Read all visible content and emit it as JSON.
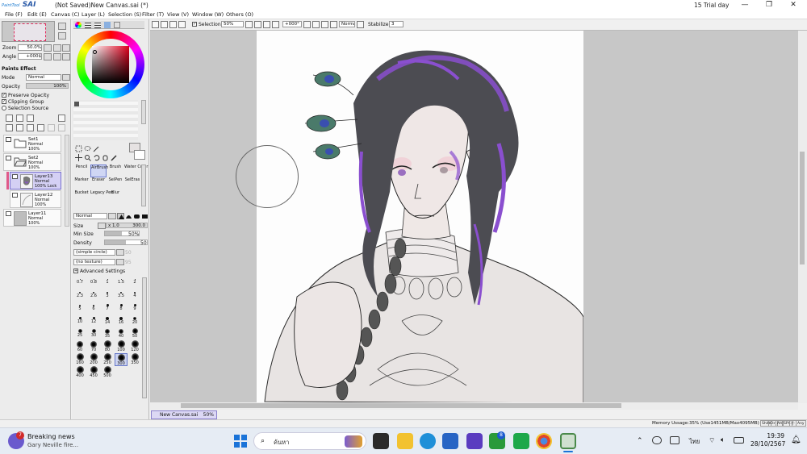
{
  "window": {
    "app_logo": "PaintTool SAI",
    "logo_small": "PaintTool",
    "logo_main": "SAI",
    "document_title": "(Not Saved)New Canvas.sai (*)",
    "trial_text": "15 Trial day",
    "minimize": "—",
    "maximize": "❐",
    "close": "✕"
  },
  "menu": [
    {
      "label": "File (F)"
    },
    {
      "label": "Edit (E)"
    },
    {
      "label": "Canvas (C)"
    },
    {
      "label": "Layer (L)"
    },
    {
      "label": "Selection (S)"
    },
    {
      "label": "Filter (T)"
    },
    {
      "label": "View (V)"
    },
    {
      "label": "Window (W)"
    },
    {
      "label": "Others (O)"
    }
  ],
  "navigator": {
    "zoom_label": "Zoom",
    "zoom_value": "50.0%",
    "angle_label": "Angle",
    "angle_value": "+000$"
  },
  "paint_effect": {
    "header": "Paints Effect",
    "mode_label": "Mode",
    "mode_value": "Normal",
    "opacity_label": "Opacity",
    "opacity_value": "100%",
    "preserve_opacity": "Preserve Opacity",
    "clipping_group": "Clipping Group",
    "selection_source": "Selection Source"
  },
  "layers": [
    {
      "name": "Set1",
      "mode": "Normal",
      "opacity": "100%",
      "type": "folder",
      "selected": false
    },
    {
      "name": "Set2",
      "mode": "Normal",
      "opacity": "100%",
      "type": "folder",
      "selected": false
    },
    {
      "name": "Layer13",
      "mode": "Normal",
      "opacity": "100% Lock",
      "type": "layer",
      "selected": true
    },
    {
      "name": "Layer12",
      "mode": "Normal",
      "opacity": "100%",
      "type": "layer",
      "selected": false
    },
    {
      "name": "Layer11",
      "mode": "Normal",
      "opacity": "100%",
      "type": "layer",
      "selected": false
    }
  ],
  "tools": [
    {
      "label": "Pencil"
    },
    {
      "label": "AirBrush",
      "selected": true
    },
    {
      "label": "Brush"
    },
    {
      "label": "Water Color"
    },
    {
      "label": "Marker"
    },
    {
      "label": "Eraser"
    },
    {
      "label": "SelPen"
    },
    {
      "label": "SelEras"
    },
    {
      "label": "Bucket"
    },
    {
      "label": "Legacy Pen"
    },
    {
      "label": "Blur"
    },
    {
      "label": ""
    }
  ],
  "brush": {
    "mode_value": "Normal",
    "size_label": "Size",
    "size_multiplier": "x 1.0",
    "size_value": "300.0",
    "min_size_label": "Min Size",
    "min_size_value": "50%",
    "min_size_level": 0.5,
    "density_label": "Density",
    "density_value": "50",
    "density_level": 0.5,
    "shape": "(simple circle)",
    "shape_value": "50",
    "texture": "(no texture)",
    "texture_value": "95",
    "advanced": "Advanced Settings",
    "sizes": [
      "0.7",
      "0.8",
      "1",
      "1.5",
      "2",
      "2.3",
      "2.6",
      "3",
      "3.5",
      "4",
      "5",
      "6",
      "7",
      "8",
      "9",
      "10",
      "12",
      "14",
      "16",
      "20",
      "25",
      "30",
      "35",
      "40",
      "50",
      "60",
      "70",
      "80",
      "100",
      "120",
      "160",
      "200",
      "250",
      "300",
      "350",
      "400",
      "450",
      "500"
    ],
    "selected_size": "300"
  },
  "toolbar": {
    "selection_label": "Selection",
    "zoom_value": "50%",
    "angle_value": "+000°",
    "mode_value": "Normal",
    "stabilizer_label": "Stabilizer",
    "stabilizer_value": "3"
  },
  "document_tab": {
    "name": "New Canvas.sai",
    "zoom": "50%"
  },
  "status": {
    "memory": "Memory Ussage:35% (Use1451MB/Max4095MB)",
    "keys": [
      "Shift",
      "Ctrl",
      "Alt",
      "SPC",
      "ⓦ",
      "Any"
    ]
  },
  "taskbar": {
    "news_badge": "7",
    "news_title": "Breaking news",
    "news_sub": "Gary Neville fire...",
    "search_placeholder": "ค้นหา",
    "store_badge": "8",
    "lang": "ไทย",
    "time": "19:39",
    "date": "28/10/2567"
  },
  "colors": {
    "accent": "#2a5aa8",
    "selection": "#d4d0f4",
    "hair_purple": "#8a4fcf",
    "hair_gray": "#4c4c52"
  }
}
